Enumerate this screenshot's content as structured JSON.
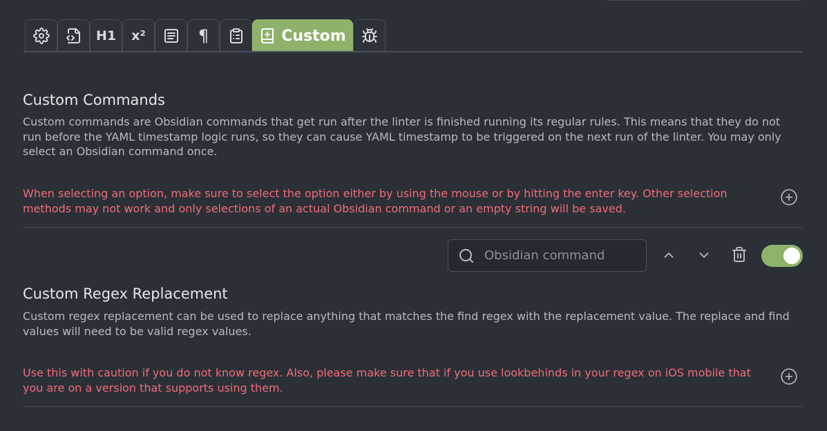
{
  "tabs": {
    "items": [
      {
        "name": "general",
        "icon": "gear-icon"
      },
      {
        "name": "yaml",
        "icon": "file-code-icon"
      },
      {
        "name": "heading",
        "icon": "heading-icon",
        "text": "H1"
      },
      {
        "name": "footnote",
        "icon": "superscript-icon",
        "text": "x²"
      },
      {
        "name": "content",
        "icon": "align-text-icon"
      },
      {
        "name": "spacing",
        "icon": "pilcrow-icon",
        "text": "¶"
      },
      {
        "name": "paste",
        "icon": "clipboard-list-icon"
      },
      {
        "name": "custom",
        "icon": "book-plus-icon",
        "label": "Custom",
        "active": true
      },
      {
        "name": "debug",
        "icon": "bug-icon"
      }
    ]
  },
  "custom_commands": {
    "title": "Custom Commands",
    "description": "Custom commands are Obsidian commands that get run after the linter is finished running its regular rules. This means that they do not run before the YAML timestamp logic runs, so they can cause YAML timestamp to be triggered on the next run of the linter. You may only select an Obsidian command once.",
    "warning": "When selecting an option, make sure to select the option either by using the mouse or by hitting the enter key. Other selection methods may not work and only selections of an actual Obsidian command or an empty string will be saved.",
    "command_input": {
      "placeholder": "Obsidian command",
      "value": ""
    },
    "enabled": true
  },
  "custom_regex": {
    "title": "Custom Regex Replacement",
    "description": "Custom regex replacement can be used to replace anything that matches the find regex with the replacement value. The replace and find values will need to be valid regex values.",
    "warning": "Use this with caution if you do not know regex. Also, please make sure that if you use lookbehinds in your regex on iOS mobile that you are on a version that supports using them."
  },
  "colors": {
    "accent": "#8fb26a",
    "warning": "#f16b78",
    "background": "#2b3037"
  }
}
